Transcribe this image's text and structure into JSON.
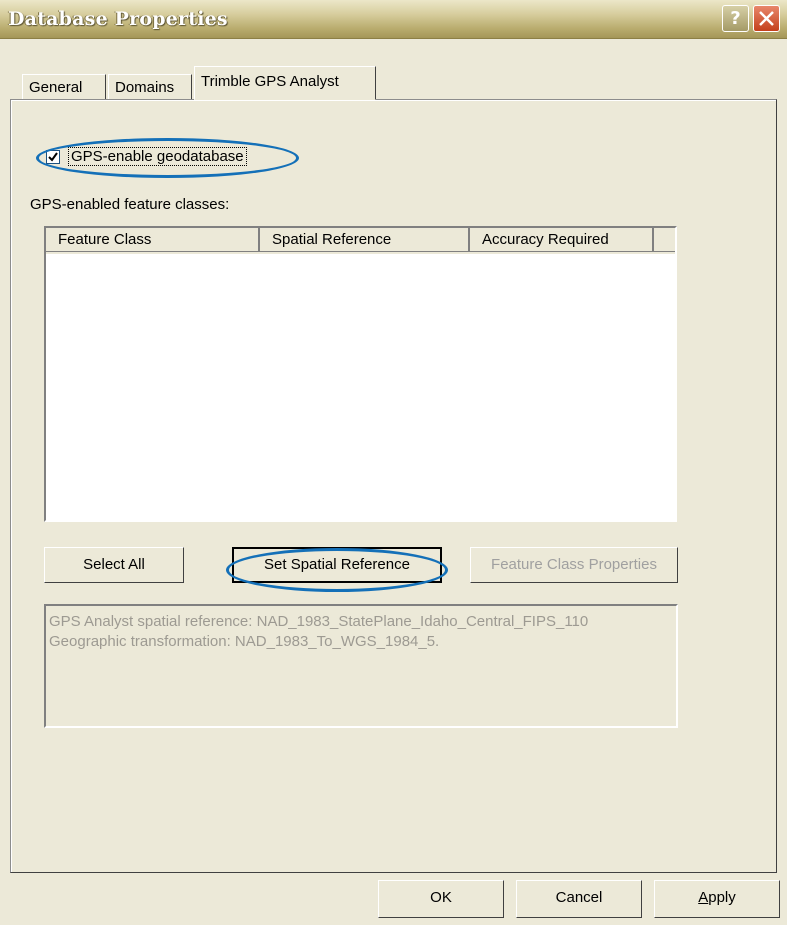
{
  "window": {
    "title": "Database Properties",
    "help_glyph": "?"
  },
  "tabs": [
    {
      "label": "General"
    },
    {
      "label": "Domains"
    },
    {
      "label": "Trimble GPS Analyst"
    }
  ],
  "gps": {
    "enable_checkbox_label": "GPS-enable geodatabase",
    "enable_checked": true,
    "list_label": "GPS-enabled feature classes:",
    "columns": [
      "Feature Class",
      "Spatial Reference",
      "Accuracy Required"
    ],
    "rows": []
  },
  "buttons": {
    "select_all": "Select All",
    "set_spatial_reference": "Set Spatial Reference",
    "feature_class_properties": "Feature Class Properties",
    "ok": "OK",
    "cancel": "Cancel",
    "apply_rest": "pply",
    "apply_mnemonic": "A"
  },
  "info": {
    "line1": "GPS Analyst spatial reference: NAD_1983_StatePlane_Idaho_Central_FIPS_110",
    "line2": "Geographic transformation: NAD_1983_To_WGS_1984_5."
  },
  "colors": {
    "highlight": "#1470b8",
    "dialog_face": "#ece9d8",
    "close_button": "#c4401c"
  }
}
